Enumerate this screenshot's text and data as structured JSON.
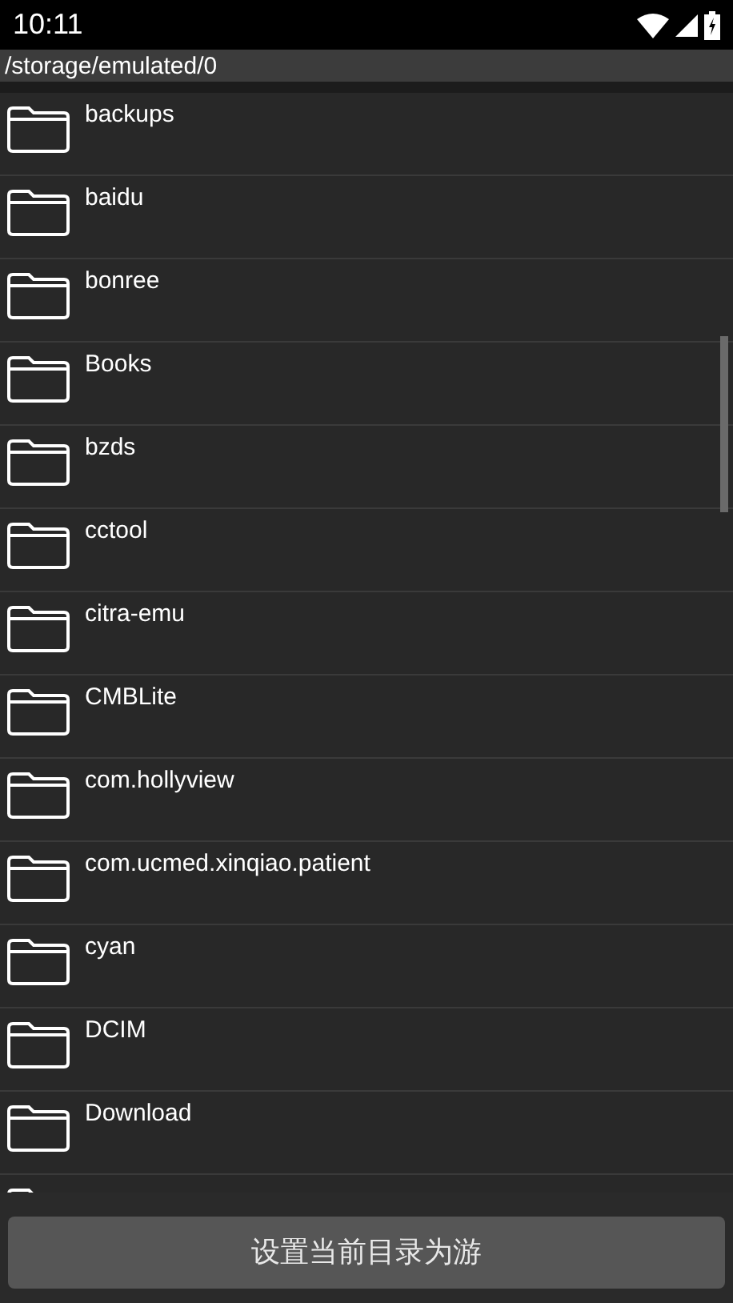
{
  "status_bar": {
    "time": "10:11"
  },
  "path_bar": {
    "path": "/storage/emulated/0"
  },
  "folders": [
    {
      "name": "backups"
    },
    {
      "name": "baidu"
    },
    {
      "name": "bonree"
    },
    {
      "name": "Books"
    },
    {
      "name": "bzds"
    },
    {
      "name": "cctool"
    },
    {
      "name": "citra-emu"
    },
    {
      "name": "CMBLite"
    },
    {
      "name": "com.hollyview"
    },
    {
      "name": "com.ucmed.xinqiao.patient"
    },
    {
      "name": "cyan"
    },
    {
      "name": "DCIM"
    },
    {
      "name": "Download"
    }
  ],
  "action_button": {
    "label": "设置当前目录为游"
  }
}
